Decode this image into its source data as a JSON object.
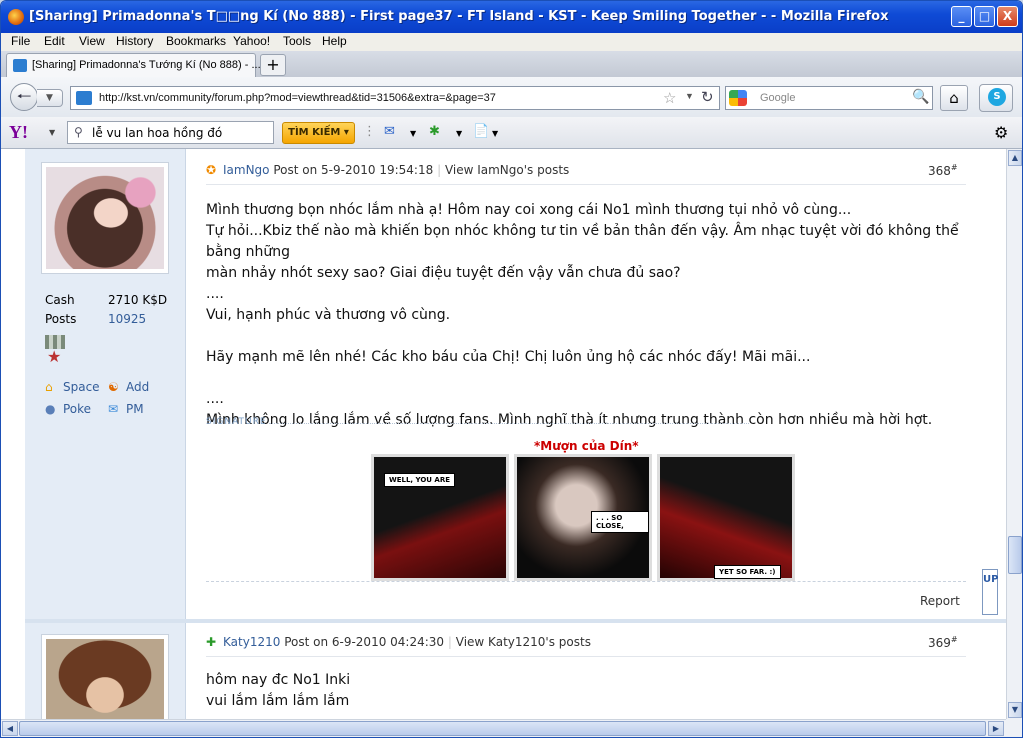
{
  "window": {
    "title": "[Sharing] Primadonna's T□□ng Kí (No 888) - First page37 - FT Island - KST - Keep Smiling Together - - Mozilla Firefox",
    "controls": [
      "_",
      "□",
      "X"
    ]
  },
  "menu": [
    "File",
    "Edit",
    "View",
    "History",
    "Bookmarks",
    "Yahoo!",
    "Tools",
    "Help"
  ],
  "tab": {
    "label": "[Sharing] Primadonna's Tướng Kí (No 888) - ...",
    "new_tab": "+"
  },
  "nav": {
    "url": "http://kst.vn/community/forum.php?mod=viewthread&tid=31506&extra=&page=37",
    "search_placeholder": "Google"
  },
  "yahoo": {
    "logo": "Y!",
    "query": "lễ vu lan hoa hồng đó",
    "search_button": "TÌM KIẾM ▾"
  },
  "post1": {
    "author": "IamNgo",
    "posted_on": "Post on 5-9-2010 19:54:18",
    "view_posts": "View IamNgo's posts",
    "number": "368",
    "cash_label": "Cash",
    "cash_value": "2710 K$D",
    "posts_label": "Posts",
    "posts_value": "10925",
    "space": "Space",
    "add": "Add",
    "poke": "Poke",
    "pm": "PM",
    "lines": [
      "Mình thương bọn nhóc lắm nhà ạ! Hôm nay coi xong cái No1 mình thương tụi nhỏ vô cùng...",
      "Tự hỏi...Kbiz thế nào mà khiến bọn nhóc không tư tin về bản thân đến vậy. Âm nhạc tuyệt vời đó không thể bằng những",
      "màn nhảy nhót sexy sao? Giai điệu tuyệt đến vậy vẫn chưa đủ sao?",
      "....",
      "Vui, hạnh  phúc và thương vô cùng.",
      "",
      "Hãy mạnh mẽ lên nhé! Các kho báu của Chị! Chị luôn ủng hộ các nhóc đấy! Mãi mãi...",
      "",
      "....",
      "Mình không lo lắng lắm về số lượng fans. Mình nghĩ thà ít nhưng trung thành còn hơn nhiều mà hời hợt."
    ],
    "signature_label": "SIGNATURE",
    "signature_caption": "*Mượn của Dín*",
    "comic": [
      "WELL, YOU ARE",
      ". . . SO CLOSE,",
      "YET SO FAR. :)"
    ],
    "report": "Report"
  },
  "post2": {
    "author": "Katy1210",
    "posted_on": "Post on 6-9-2010 04:24:30",
    "view_posts": "View Katy1210's posts",
    "number": "369",
    "lines": [
      "hôm nay đc No1 Inki",
      "vui lắm lắm lắm lắm"
    ]
  },
  "up_button": "UP"
}
